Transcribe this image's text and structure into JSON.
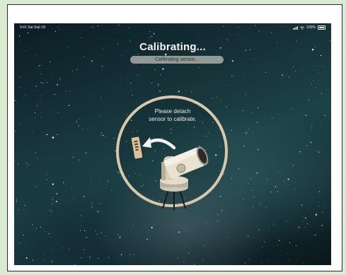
{
  "status_bar": {
    "time": "9:41 Sat Sep 18",
    "battery": "100%"
  },
  "calibration": {
    "title": "Calibrating...",
    "subtitle": "Calibrating sensor...",
    "instruction_line1": "Please detach",
    "instruction_line2": "sensor to calibrate."
  },
  "icons": [
    "sensor-icon",
    "curved-arrow-icon",
    "telescope-icon",
    "wifi-icon",
    "signal-icon",
    "battery-icon"
  ],
  "colors": {
    "frame_background": "#d7ecd2",
    "ring": "#d8c8a8",
    "sky_dark": "#0b1d24",
    "sky_teal": "#1c4347"
  }
}
